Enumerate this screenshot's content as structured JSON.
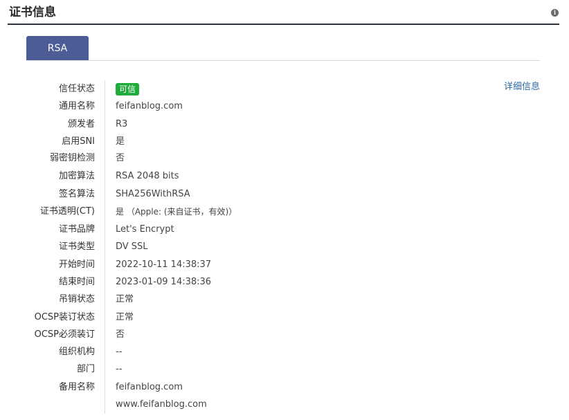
{
  "header": {
    "title": "证书信息",
    "info_icon": "info-icon"
  },
  "tabs": [
    {
      "label": "RSA",
      "active": true
    }
  ],
  "detail_link": "详细信息",
  "rows": [
    {
      "label": "信任状态",
      "value": "可信",
      "badge_color": "#1fac3b"
    },
    {
      "label": "通用名称",
      "value": "feifanblog.com"
    },
    {
      "label": "颁发者",
      "value": "R3"
    },
    {
      "label": "启用SNI",
      "value": "是"
    },
    {
      "label": "弱密钥检测",
      "value": "否"
    },
    {
      "label": "加密算法",
      "value": "RSA 2048 bits"
    },
    {
      "label": "签名算法",
      "value": "SHA256WithRSA"
    },
    {
      "label": "证书透明(CT)",
      "value": "是 （Apple: (来自证书，有效)）"
    },
    {
      "label": "证书品牌",
      "value": "Let's Encrypt"
    },
    {
      "label": "证书类型",
      "value": "DV SSL"
    },
    {
      "label": "开始时间",
      "value": "2022-10-11 14:38:37"
    },
    {
      "label": "结束时间",
      "value": "2023-01-09 14:38:36"
    },
    {
      "label": "吊销状态",
      "value": "正常"
    },
    {
      "label": "OCSP装订状态",
      "value": "正常"
    },
    {
      "label": "OCSP必须装订",
      "value": "否"
    },
    {
      "label": "组织机构",
      "value": "--"
    },
    {
      "label": "部门",
      "value": "--"
    },
    {
      "label": "备用名称",
      "value": "feifanblog.com"
    },
    {
      "label": "",
      "value": "www.feifanblog.com"
    }
  ]
}
